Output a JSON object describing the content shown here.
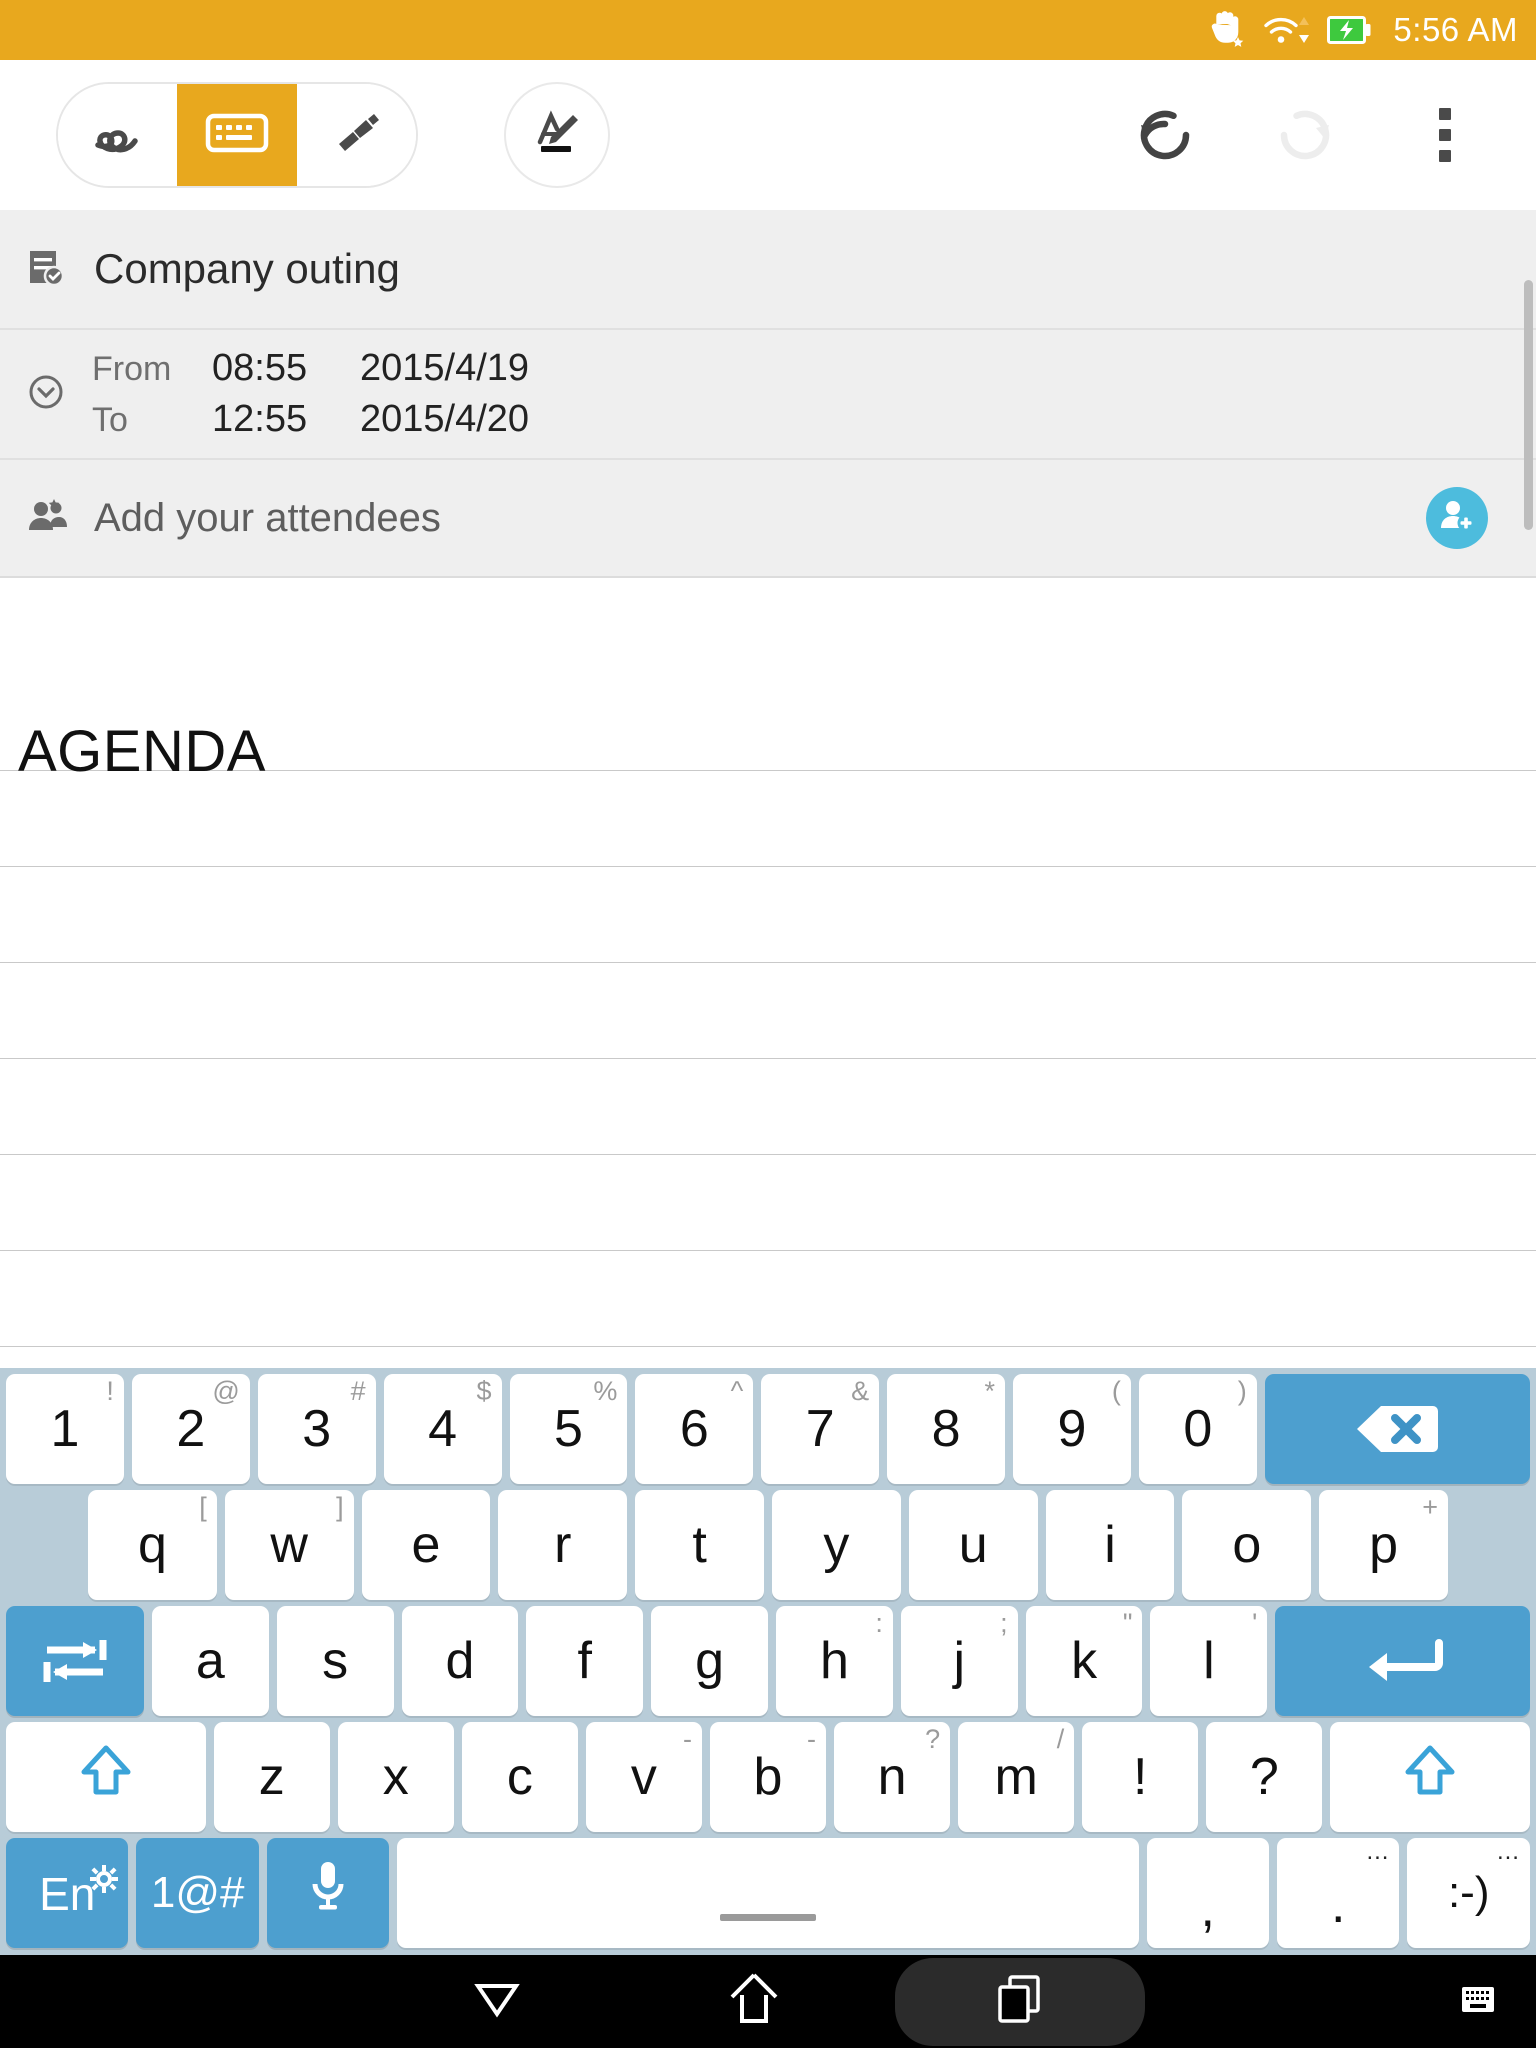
{
  "statusbar": {
    "time": "5:56 AM",
    "icons": [
      "hand-star-icon",
      "wifi-icon",
      "battery-charging-icon"
    ]
  },
  "toolbar": {
    "segmented": [
      {
        "name": "scribble-tool",
        "icon": "squiggle-pen-icon",
        "active": false
      },
      {
        "name": "keyboard-tool",
        "icon": "keyboard-icon",
        "active": true
      },
      {
        "name": "highlighter-tool",
        "icon": "marker-icon",
        "active": false
      }
    ],
    "format_button": {
      "name": "text-format-button",
      "icon": "a-pencil-icon"
    },
    "undo": {
      "label": "undo-icon",
      "enabled": true
    },
    "redo": {
      "label": "redo-icon",
      "enabled": false
    },
    "overflow": {
      "label": "more-options-icon"
    }
  },
  "note": {
    "title": "Company outing",
    "title_icon": "note-checked-icon",
    "schedule": {
      "icon": "clock-icon",
      "from_label": "From",
      "from_time": "08:55",
      "from_date": "2015/4/19",
      "to_label": "To",
      "to_time": "12:55",
      "to_date": "2015/4/20"
    },
    "attendees": {
      "icon": "people-icon",
      "placeholder": "Add your attendees",
      "add_button_icon": "add-person-icon",
      "add_button_color": "#4dbcdd"
    },
    "content_heading": "AGENDA",
    "ruled_line_count": 7
  },
  "keyboard": {
    "accent_color": "#4d9fcf",
    "background": "#b8ccd8",
    "rows": {
      "numbers": [
        {
          "main": "1",
          "sec": "!"
        },
        {
          "main": "2",
          "sec": "@"
        },
        {
          "main": "3",
          "sec": "#"
        },
        {
          "main": "4",
          "sec": "$"
        },
        {
          "main": "5",
          "sec": "%"
        },
        {
          "main": "6",
          "sec": "^"
        },
        {
          "main": "7",
          "sec": "&"
        },
        {
          "main": "8",
          "sec": "*"
        },
        {
          "main": "9",
          "sec": "("
        },
        {
          "main": "0",
          "sec": ")"
        }
      ],
      "backspace": {
        "name": "backspace-key",
        "icon": "backspace-icon"
      },
      "top": [
        {
          "main": "q",
          "sec": "["
        },
        {
          "main": "w",
          "sec": "]"
        },
        {
          "main": "e",
          "sec": ""
        },
        {
          "main": "r",
          "sec": ""
        },
        {
          "main": "t",
          "sec": ""
        },
        {
          "main": "y",
          "sec": ""
        },
        {
          "main": "u",
          "sec": ""
        },
        {
          "main": "i",
          "sec": ""
        },
        {
          "main": "o",
          "sec": ""
        },
        {
          "main": "p",
          "sec": "+"
        }
      ],
      "tab": {
        "name": "tab-key",
        "icon": "tab-icon"
      },
      "home": [
        {
          "main": "a",
          "sec": ""
        },
        {
          "main": "s",
          "sec": ""
        },
        {
          "main": "d",
          "sec": ""
        },
        {
          "main": "f",
          "sec": ""
        },
        {
          "main": "g",
          "sec": ""
        },
        {
          "main": "h",
          "sec": ":"
        },
        {
          "main": "j",
          "sec": ";"
        },
        {
          "main": "k",
          "sec": "\""
        },
        {
          "main": "l",
          "sec": "'"
        }
      ],
      "enter": {
        "name": "enter-key",
        "icon": "enter-icon"
      },
      "shift_left": {
        "name": "shift-left-key",
        "icon": "shift-icon"
      },
      "bottom": [
        {
          "main": "z",
          "sec": ""
        },
        {
          "main": "x",
          "sec": ""
        },
        {
          "main": "c",
          "sec": ""
        },
        {
          "main": "v",
          "sec": "-"
        },
        {
          "main": "b",
          "sec": "-"
        },
        {
          "main": "n",
          "sec": "?"
        },
        {
          "main": "m",
          "sec": "/"
        },
        {
          "main": "!",
          "sec": ""
        },
        {
          "main": "?",
          "sec": ""
        }
      ],
      "shift_right": {
        "name": "shift-right-key",
        "icon": "shift-icon"
      },
      "lang": {
        "label": "En",
        "icon": "gear-icon"
      },
      "symbols": {
        "label": "1@#"
      },
      "mic": {
        "icon": "microphone-icon"
      },
      "space": {
        "label": ""
      },
      "comma": {
        "main": ",",
        "sec": ""
      },
      "period": {
        "main": ".",
        "sec": "..."
      },
      "emoji": {
        "main": ":-)",
        "sec": "..."
      }
    }
  },
  "navbar": {
    "back": {
      "name": "back-down-triangle-icon"
    },
    "home": {
      "name": "home-icon"
    },
    "recents": {
      "name": "recent-apps-icon",
      "highlighted": true
    },
    "keyboard_toggle": {
      "name": "keyboard-toggle-icon"
    }
  }
}
